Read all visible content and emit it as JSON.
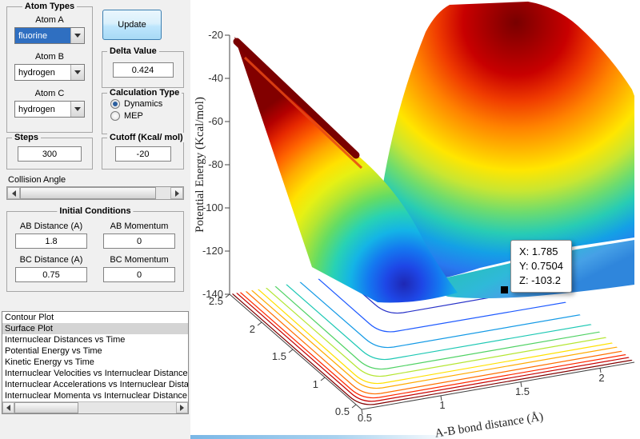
{
  "colors": {
    "selection_blue": "#2f6fc1",
    "update_button_border": "#3c7fb1",
    "list_selection_gray": "#d4d4d4",
    "panel_background": "#f0f0f0",
    "figure_background": "#ffffff"
  },
  "controls": {
    "atom_types": {
      "title": "Atom Types",
      "fields": [
        {
          "label": "Atom A",
          "value": "fluorine"
        },
        {
          "label": "Atom B",
          "value": "hydrogen"
        },
        {
          "label": "Atom C",
          "value": "hydrogen"
        }
      ]
    },
    "update_button": {
      "label": "Update"
    },
    "delta_value": {
      "title": "Delta Value",
      "value": "0.424"
    },
    "calculation_type": {
      "title": "Calculation Type",
      "options": [
        {
          "label": "Dynamics",
          "selected": true
        },
        {
          "label": "MEP",
          "selected": false
        }
      ]
    },
    "steps": {
      "title": "Steps",
      "value": "300"
    },
    "cutoff": {
      "title": "Cutoff (Kcal/ mol)",
      "value": "-20"
    },
    "collision_angle": {
      "label": "Collision Angle"
    },
    "initial_conditions": {
      "title": "Initial Conditions",
      "fields": [
        {
          "label": "AB Distance (A)",
          "value": "1.8"
        },
        {
          "label": "AB Momentum",
          "value": "0"
        },
        {
          "label": "BC Distance (A)",
          "value": "0.75"
        },
        {
          "label": "BC Momentum",
          "value": "0"
        }
      ]
    },
    "plot_list": {
      "selected": "Surface Plot",
      "items": [
        "Contour Plot",
        "Surface Plot",
        "Internuclear Distances vs Time",
        "Potential Energy vs Time",
        "Kinetic Energy vs Time",
        "Internuclear Velocities vs Internuclear Distance",
        "Internuclear Accelerations vs Internuclear Dista",
        "Internuclear Momenta vs Internuclear Distance"
      ]
    }
  },
  "chart_data": {
    "type": "3d-surface-with-floor-contour",
    "colormap": "jet",
    "ylabel": "Potential Energy (Kcal/mol)",
    "xlabel": "A-B bond distance (Å)",
    "z_ticks": [
      "-20",
      "-40",
      "-60",
      "-80",
      "-100",
      "-120",
      "-140"
    ],
    "x_ticks": [
      "0.5",
      "1",
      "1.5",
      "2"
    ],
    "depth_ticks": [
      "2.5",
      "2",
      "1.5",
      "1",
      "0.5"
    ],
    "z_range": [
      -140,
      -20
    ],
    "datatip": {
      "lines": [
        "X: 1.785",
        "Y: 0.7504",
        "Z: -103.2"
      ],
      "x": 1.785,
      "y": 0.7504,
      "z": -103.2
    }
  }
}
